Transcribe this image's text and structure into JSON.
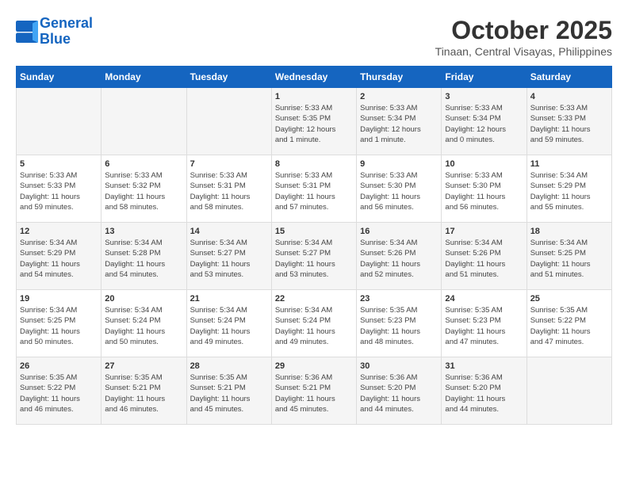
{
  "header": {
    "logo_line1": "General",
    "logo_line2": "Blue",
    "title": "October 2025",
    "subtitle": "Tinaan, Central Visayas, Philippines"
  },
  "columns": [
    "Sunday",
    "Monday",
    "Tuesday",
    "Wednesday",
    "Thursday",
    "Friday",
    "Saturday"
  ],
  "weeks": [
    {
      "cells": [
        {
          "day": "",
          "info": ""
        },
        {
          "day": "",
          "info": ""
        },
        {
          "day": "",
          "info": ""
        },
        {
          "day": "1",
          "info": "Sunrise: 5:33 AM\nSunset: 5:35 PM\nDaylight: 12 hours\nand 1 minute."
        },
        {
          "day": "2",
          "info": "Sunrise: 5:33 AM\nSunset: 5:34 PM\nDaylight: 12 hours\nand 1 minute."
        },
        {
          "day": "3",
          "info": "Sunrise: 5:33 AM\nSunset: 5:34 PM\nDaylight: 12 hours\nand 0 minutes."
        },
        {
          "day": "4",
          "info": "Sunrise: 5:33 AM\nSunset: 5:33 PM\nDaylight: 11 hours\nand 59 minutes."
        }
      ]
    },
    {
      "cells": [
        {
          "day": "5",
          "info": "Sunrise: 5:33 AM\nSunset: 5:33 PM\nDaylight: 11 hours\nand 59 minutes."
        },
        {
          "day": "6",
          "info": "Sunrise: 5:33 AM\nSunset: 5:32 PM\nDaylight: 11 hours\nand 58 minutes."
        },
        {
          "day": "7",
          "info": "Sunrise: 5:33 AM\nSunset: 5:31 PM\nDaylight: 11 hours\nand 58 minutes."
        },
        {
          "day": "8",
          "info": "Sunrise: 5:33 AM\nSunset: 5:31 PM\nDaylight: 11 hours\nand 57 minutes."
        },
        {
          "day": "9",
          "info": "Sunrise: 5:33 AM\nSunset: 5:30 PM\nDaylight: 11 hours\nand 56 minutes."
        },
        {
          "day": "10",
          "info": "Sunrise: 5:33 AM\nSunset: 5:30 PM\nDaylight: 11 hours\nand 56 minutes."
        },
        {
          "day": "11",
          "info": "Sunrise: 5:34 AM\nSunset: 5:29 PM\nDaylight: 11 hours\nand 55 minutes."
        }
      ]
    },
    {
      "cells": [
        {
          "day": "12",
          "info": "Sunrise: 5:34 AM\nSunset: 5:29 PM\nDaylight: 11 hours\nand 54 minutes."
        },
        {
          "day": "13",
          "info": "Sunrise: 5:34 AM\nSunset: 5:28 PM\nDaylight: 11 hours\nand 54 minutes."
        },
        {
          "day": "14",
          "info": "Sunrise: 5:34 AM\nSunset: 5:27 PM\nDaylight: 11 hours\nand 53 minutes."
        },
        {
          "day": "15",
          "info": "Sunrise: 5:34 AM\nSunset: 5:27 PM\nDaylight: 11 hours\nand 53 minutes."
        },
        {
          "day": "16",
          "info": "Sunrise: 5:34 AM\nSunset: 5:26 PM\nDaylight: 11 hours\nand 52 minutes."
        },
        {
          "day": "17",
          "info": "Sunrise: 5:34 AM\nSunset: 5:26 PM\nDaylight: 11 hours\nand 51 minutes."
        },
        {
          "day": "18",
          "info": "Sunrise: 5:34 AM\nSunset: 5:25 PM\nDaylight: 11 hours\nand 51 minutes."
        }
      ]
    },
    {
      "cells": [
        {
          "day": "19",
          "info": "Sunrise: 5:34 AM\nSunset: 5:25 PM\nDaylight: 11 hours\nand 50 minutes."
        },
        {
          "day": "20",
          "info": "Sunrise: 5:34 AM\nSunset: 5:24 PM\nDaylight: 11 hours\nand 50 minutes."
        },
        {
          "day": "21",
          "info": "Sunrise: 5:34 AM\nSunset: 5:24 PM\nDaylight: 11 hours\nand 49 minutes."
        },
        {
          "day": "22",
          "info": "Sunrise: 5:34 AM\nSunset: 5:24 PM\nDaylight: 11 hours\nand 49 minutes."
        },
        {
          "day": "23",
          "info": "Sunrise: 5:35 AM\nSunset: 5:23 PM\nDaylight: 11 hours\nand 48 minutes."
        },
        {
          "day": "24",
          "info": "Sunrise: 5:35 AM\nSunset: 5:23 PM\nDaylight: 11 hours\nand 47 minutes."
        },
        {
          "day": "25",
          "info": "Sunrise: 5:35 AM\nSunset: 5:22 PM\nDaylight: 11 hours\nand 47 minutes."
        }
      ]
    },
    {
      "cells": [
        {
          "day": "26",
          "info": "Sunrise: 5:35 AM\nSunset: 5:22 PM\nDaylight: 11 hours\nand 46 minutes."
        },
        {
          "day": "27",
          "info": "Sunrise: 5:35 AM\nSunset: 5:21 PM\nDaylight: 11 hours\nand 46 minutes."
        },
        {
          "day": "28",
          "info": "Sunrise: 5:35 AM\nSunset: 5:21 PM\nDaylight: 11 hours\nand 45 minutes."
        },
        {
          "day": "29",
          "info": "Sunrise: 5:36 AM\nSunset: 5:21 PM\nDaylight: 11 hours\nand 45 minutes."
        },
        {
          "day": "30",
          "info": "Sunrise: 5:36 AM\nSunset: 5:20 PM\nDaylight: 11 hours\nand 44 minutes."
        },
        {
          "day": "31",
          "info": "Sunrise: 5:36 AM\nSunset: 5:20 PM\nDaylight: 11 hours\nand 44 minutes."
        },
        {
          "day": "",
          "info": ""
        }
      ]
    }
  ]
}
